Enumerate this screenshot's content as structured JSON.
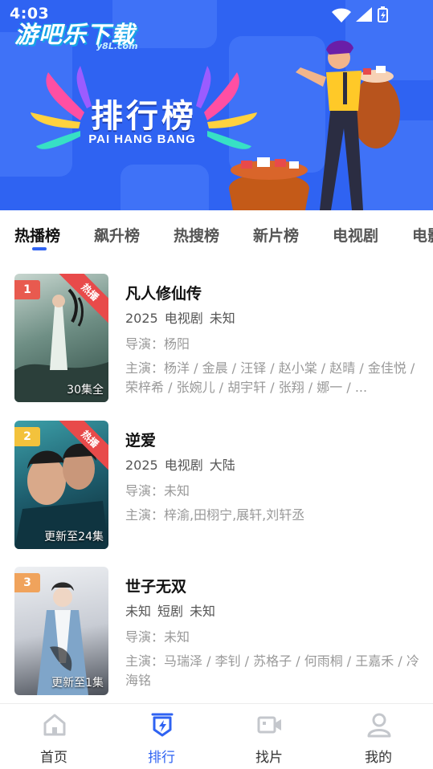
{
  "status_bar": {
    "time": "4:03"
  },
  "watermark": {
    "cn": "游吧乐下载",
    "en": "y8L.com"
  },
  "banner": {
    "title": "排行榜",
    "subtitle": "PAI HANG BANG"
  },
  "tabs": [
    {
      "label": "热播榜",
      "active": true
    },
    {
      "label": "飙升榜",
      "active": false
    },
    {
      "label": "热搜榜",
      "active": false
    },
    {
      "label": "新片榜",
      "active": false
    },
    {
      "label": "电视剧",
      "active": false
    },
    {
      "label": "电影",
      "active": false
    }
  ],
  "list": [
    {
      "rank": "1",
      "ribbon": "热播",
      "poster_note": "30集全",
      "title": "凡人修仙传",
      "year": "2025",
      "category": "电视剧",
      "region": "未知",
      "director": "导演：杨阳",
      "cast": "主演：杨洋 / 金晨 / 汪铎 / 赵小棠 / 赵晴 / 金佳悦 / 荣梓希 / 张婉儿 / 胡宇轩 / 张翔 / 娜一 / ..."
    },
    {
      "rank": "2",
      "ribbon": "热播",
      "poster_note": "更新至24集",
      "title": "逆爱",
      "year": "2025",
      "category": "电视剧",
      "region": "大陆",
      "director": "导演：未知",
      "cast": "主演：梓渝,田栩宁,展轩,刘轩丞"
    },
    {
      "rank": "3",
      "ribbon": "",
      "poster_note": "更新至1集",
      "title": "世子无双",
      "year": "未知",
      "category": "短剧",
      "region": "未知",
      "director": "导演：未知",
      "cast": "主演：马瑞泽 / 李钊 / 苏格子 / 何雨桐 / 王嘉禾 / 冷海铭"
    }
  ],
  "bottom_nav": [
    {
      "label": "首页",
      "icon": "home-icon",
      "active": false
    },
    {
      "label": "排行",
      "icon": "ranking-icon",
      "active": true
    },
    {
      "label": "找片",
      "icon": "video-camera-icon",
      "active": false
    },
    {
      "label": "我的",
      "icon": "user-icon",
      "active": false
    }
  ],
  "colors": {
    "accent": "#2f63f2",
    "banner_bg": "#2f63f2",
    "rank1": "#e85a4f",
    "rank2": "#f3c23c",
    "rank3": "#f0a35c",
    "ribbon": "#e84a4a"
  }
}
